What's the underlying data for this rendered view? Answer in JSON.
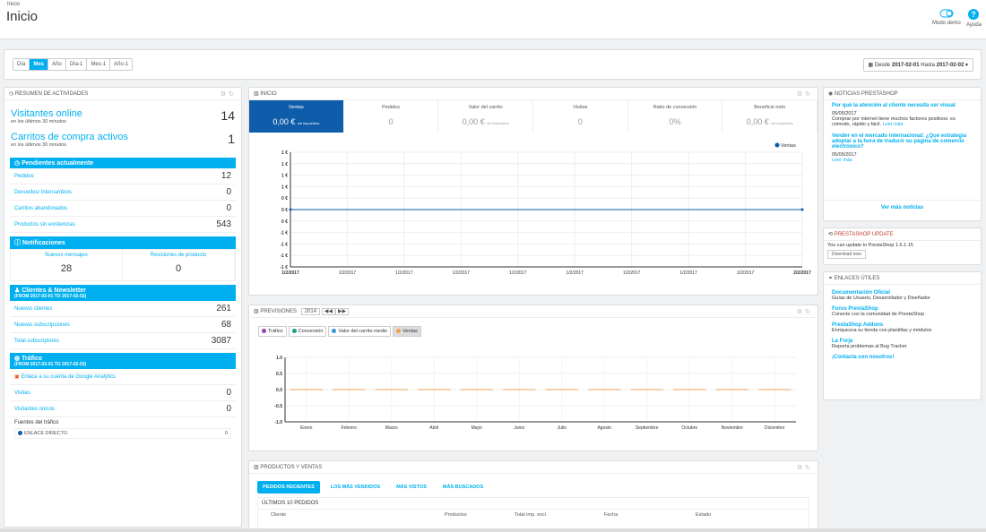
{
  "breadcrumb": "Inicio",
  "page_title": "Inicio",
  "toolbar": {
    "demo": "Modo demo",
    "help": "Ayuda"
  },
  "filters": {
    "periods": [
      "Día",
      "Mes",
      "Año",
      "Día-1",
      "Mes-1",
      "Año-1"
    ],
    "active": "Mes",
    "date_label_from": "Desde",
    "date_from": "2017-02-01",
    "date_label_to": "Hasta",
    "date_to": "2017-02-02"
  },
  "activity": {
    "title": "Resumen de actividades",
    "visitors_label": "Visitantes online",
    "visitors_sub": "en los últimos 30 minutos",
    "visitors_val": "14",
    "carts_label": "Carritos de compra activos",
    "carts_sub": "en los últimos 30 minutos",
    "carts_val": "1",
    "pending_title": "Pendientes actualmente",
    "pending": [
      {
        "l": "Pedidos",
        "v": "12"
      },
      {
        "l": "Devuellos/ Intercambios",
        "v": "0"
      },
      {
        "l": "Carritos abandonados",
        "v": "0"
      },
      {
        "l": "Productos sin existencias",
        "v": "543"
      }
    ],
    "notif_title": "Notificaciones",
    "notif": [
      {
        "l": "Nuevos mensajes",
        "v": "28"
      },
      {
        "l": "Revisiones de producto",
        "v": "0"
      }
    ],
    "clients_title": "Clientes & Newsletter",
    "clients_sub": "(FROM 2017-02-01 TO 2017-02-02)",
    "clients": [
      {
        "l": "Nuevos clientes",
        "v": "261"
      },
      {
        "l": "Nuevas subscripciones",
        "v": "68"
      },
      {
        "l": "Total subscriptores",
        "v": "3087"
      }
    ],
    "traffic_title": "Tráfico",
    "traffic_sub": "(FROM 2017-02-01 TO 2017-02-02)",
    "ga_link": "Enlace a su cuenta de Google Analytics",
    "traffic": [
      {
        "l": "Visitas",
        "v": "0"
      },
      {
        "l": "Visitantes únicos",
        "v": "0"
      }
    ],
    "sources_title": "Fuentes del tráfico",
    "source_name": "ENLACE DIRECTO",
    "source_val": "0"
  },
  "dashboard": {
    "title": "Inicio",
    "kpis": [
      {
        "t": "Ventas",
        "v": "0,00 €",
        "s": "sin impuestos"
      },
      {
        "t": "Pedidos",
        "v": "0",
        "s": ""
      },
      {
        "t": "Valor del carrito",
        "v": "0,00 €",
        "s": "sin impuestos"
      },
      {
        "t": "Visitas",
        "v": "0",
        "s": ""
      },
      {
        "t": "Ratio de conversión",
        "v": "0%",
        "s": ""
      },
      {
        "t": "Beneficio neto",
        "v": "0,00 €",
        "s": "sin impuestos"
      }
    ]
  },
  "forecast": {
    "title": "Previsiones",
    "year": "2014",
    "tabs": [
      "Tráfico",
      "Conversión",
      "Valor del carrito medio",
      "Ventas"
    ],
    "active": "Ventas"
  },
  "products": {
    "title": "Productos y ventas",
    "tabs": [
      "Pedidos recientes",
      "Los más vendidos",
      "Más vistos",
      "Más buscados"
    ],
    "subtitle": "ÚLTIMOS 10 PEDIDOS",
    "cols": [
      "Cliente",
      "Productos",
      "Total imp. excl.",
      "Fecha",
      "Estado"
    ]
  },
  "news": {
    "title": "Noticias PrestaShop",
    "items": [
      {
        "t": "Por qué la atención al cliente necesita ser visual",
        "d": "05/05/2017",
        "p": "Comprar por internet tiene muchos factores positivos: es cómodo, rápido y fácil.",
        "more": "Leer más"
      },
      {
        "t": "Vender en el mercado internacional: ¿Qué estrategia adoptar a la hora de traducir su página de comercio electrónico?",
        "d": "05/05/2017",
        "p": "",
        "more": "Leer más"
      }
    ],
    "all": "Ver más noticias"
  },
  "update": {
    "title": "PrestaShop Update",
    "text": "You can update to PrestaShop 1.6.1.15",
    "btn": "Download now"
  },
  "links": {
    "title": "Enlaces útiles",
    "items": [
      {
        "t": "Documentación Oficial",
        "d": "Guías de Usuario, Desarrollador y Diseñador"
      },
      {
        "t": "Foros PrestaShop",
        "d": "Conecte con la comunidad de PrestaShop"
      },
      {
        "t": "PrestaShop Addons",
        "d": "Enriquezca su tienda con plantillas y módulos"
      },
      {
        "t": "La Forja",
        "d": "Reporta problemas al Bug Tracker"
      },
      {
        "t": "¡Contacta con nosotros!",
        "d": ""
      }
    ]
  },
  "chart_data": [
    {
      "type": "line",
      "series": [
        {
          "name": "Ventas",
          "values": [
            0,
            0,
            0,
            0,
            0,
            0,
            0,
            0,
            0,
            0
          ]
        }
      ],
      "categories": [
        "1/2/2017",
        "1/2/2017",
        "1/2/2017",
        "1/2/2017",
        "1/2/2017",
        "1/2/2017",
        "1/2/2017",
        "1/2/2017",
        "1/2/2017",
        "2/2/2017"
      ],
      "yticks": [
        "1 €",
        "1 €",
        "1 €",
        "1 €",
        "0 €",
        "0 €",
        "0 €",
        "-1 €",
        "-1 €",
        "-1 €",
        "-1 €"
      ],
      "ylim": [
        -1,
        1
      ],
      "legend": "top-right",
      "color": "#0e5caa"
    },
    {
      "type": "bar",
      "categories": [
        "Enero",
        "Febrero",
        "Marzo",
        "Abril",
        "Mayo",
        "Junio",
        "Julio",
        "Agosto",
        "Septiembre",
        "Octubre",
        "Noviembre",
        "Diciembre"
      ],
      "yticks": [
        "1.0",
        "0.5",
        "0.0",
        "-0.5",
        "-1.0"
      ],
      "ylim": [
        -1,
        1
      ],
      "series": [
        {
          "name": "Ventas",
          "values": [
            0,
            0,
            0,
            0,
            0,
            0,
            0,
            0,
            0,
            0,
            0,
            0
          ]
        }
      ],
      "color": "#f0a050"
    }
  ],
  "colors": {
    "accent": "#00aff0",
    "dark_accent": "#0e5caa",
    "forecast": "#f0a050"
  }
}
